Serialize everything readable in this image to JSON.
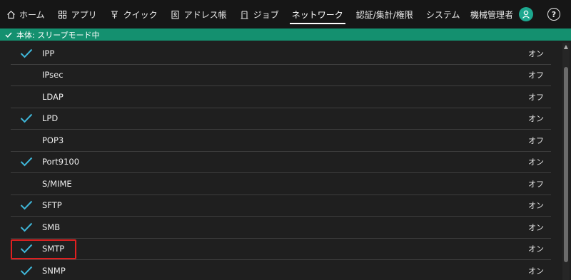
{
  "nav": {
    "items": [
      {
        "label": "ホーム",
        "icon": "home-icon"
      },
      {
        "label": "アプリ",
        "icon": "apps-grid-icon"
      },
      {
        "label": "クイック",
        "icon": "quick-icon"
      },
      {
        "label": "アドレス帳",
        "icon": "address-book-icon"
      },
      {
        "label": "ジョブ",
        "icon": "job-icon"
      },
      {
        "label": "ネットワーク",
        "icon": ""
      },
      {
        "label": "認証/集計/権限",
        "icon": ""
      },
      {
        "label": "システム",
        "icon": ""
      }
    ],
    "active": "ネットワーク"
  },
  "user": {
    "label": "機械管理者",
    "icon": "user-avatar-icon"
  },
  "help_icon": "help-icon",
  "status": {
    "text": "本体: スリープモード中",
    "icon": "check-icon"
  },
  "protocols": [
    {
      "name": "IPP",
      "state": "オン",
      "checked": true
    },
    {
      "name": "IPsec",
      "state": "オフ",
      "checked": false
    },
    {
      "name": "LDAP",
      "state": "オフ",
      "checked": false
    },
    {
      "name": "LPD",
      "state": "オン",
      "checked": true
    },
    {
      "name": "POP3",
      "state": "オフ",
      "checked": false
    },
    {
      "name": "Port9100",
      "state": "オン",
      "checked": true
    },
    {
      "name": "S/MIME",
      "state": "オフ",
      "checked": false
    },
    {
      "name": "SFTP",
      "state": "オン",
      "checked": true
    },
    {
      "name": "SMB",
      "state": "オン",
      "checked": true
    },
    {
      "name": "SMTP",
      "state": "オン",
      "checked": true
    },
    {
      "name": "SNMP",
      "state": "オン",
      "checked": true
    }
  ],
  "colors": {
    "accent": "#14906f",
    "check": "#3fb6d8",
    "highlight": "#e02020"
  }
}
